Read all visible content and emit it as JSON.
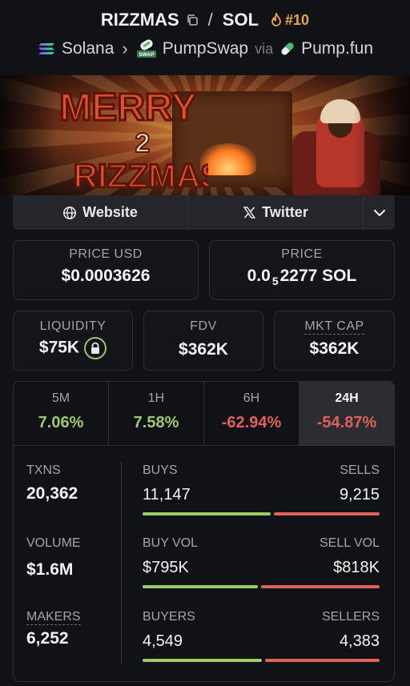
{
  "header": {
    "base": "RIZZMAS",
    "separator": "/",
    "quote": "SOL",
    "rank": "#10",
    "chain": "Solana",
    "dex": "PumpSwap",
    "via": "via",
    "launchpad": "Pump.fun"
  },
  "banner": {
    "line1": "MERRY",
    "line2": "2",
    "line3": "RIZZMAS"
  },
  "links": {
    "website": "Website",
    "twitter": "Twitter"
  },
  "price": {
    "usd_label": "PRICE USD",
    "usd_value": "$0.0003626",
    "native_label": "PRICE",
    "native_prefix": "0.0",
    "native_zeros": "5",
    "native_digits": "2277 SOL"
  },
  "metrics": {
    "liquidity_label": "LIQUIDITY",
    "liquidity_value": "$75K",
    "fdv_label": "FDV",
    "fdv_value": "$362K",
    "mktcap_label": "MKT CAP",
    "mktcap_value": "$362K"
  },
  "timeframes": [
    {
      "label": "5M",
      "value": "7.06%",
      "direction": "up"
    },
    {
      "label": "1H",
      "value": "7.58%",
      "direction": "up"
    },
    {
      "label": "6H",
      "value": "-62.94%",
      "direction": "down"
    },
    {
      "label": "24H",
      "value": "-54.87%",
      "direction": "down",
      "selected": true
    }
  ],
  "stats": {
    "txns_label": "TXNS",
    "txns_value": "20,362",
    "volume_label": "VOLUME",
    "volume_value": "$1.6M",
    "makers_label": "MAKERS",
    "makers_value": "6,252",
    "buys_label": "BUYS",
    "buys_value": "11,147",
    "sells_label": "SELLS",
    "sells_value": "9,215",
    "buyvol_label": "BUY VOL",
    "buyvol_value": "$795K",
    "sellvol_label": "SELL VOL",
    "sellvol_value": "$818K",
    "buyers_label": "BUYERS",
    "buyers_value": "4,549",
    "sellers_label": "SELLERS",
    "sellers_value": "4,383"
  },
  "ratios": {
    "buys_share": 0.547,
    "buyvol_share": 0.493,
    "buyers_share": 0.509
  },
  "colors": {
    "accent_green": "#9ecb6a",
    "accent_red": "#e0605a",
    "rank_orange": "#f0a33a"
  }
}
